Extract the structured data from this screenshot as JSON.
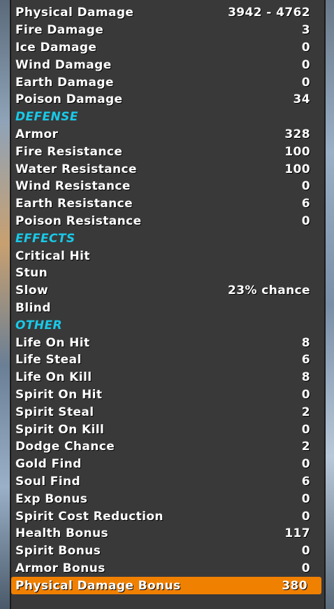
{
  "colors": {
    "section_header": "#19c9e8",
    "highlight": "#f08000",
    "panel": "#393939"
  },
  "rows": [
    {
      "label": "Physical Damage",
      "value": "3942 - 4762"
    },
    {
      "label": "Fire Damage",
      "value": "3"
    },
    {
      "label": "Ice Damage",
      "value": "0"
    },
    {
      "label": "Wind Damage",
      "value": "0"
    },
    {
      "label": "Earth Damage",
      "value": "0"
    },
    {
      "label": "Poison Damage",
      "value": "34"
    },
    {
      "label": "DEFENSE",
      "header": true
    },
    {
      "label": "Armor",
      "value": "328"
    },
    {
      "label": "Fire Resistance",
      "value": "100"
    },
    {
      "label": "Water Resistance",
      "value": "100"
    },
    {
      "label": "Wind Resistance",
      "value": "0"
    },
    {
      "label": "Earth Resistance",
      "value": "6"
    },
    {
      "label": "Poison Resistance",
      "value": "0"
    },
    {
      "label": "EFFECTS",
      "header": true
    },
    {
      "label": "Critical Hit",
      "value": ""
    },
    {
      "label": "Stun",
      "value": ""
    },
    {
      "label": "Slow",
      "value": "23% chance"
    },
    {
      "label": "Blind",
      "value": ""
    },
    {
      "label": "OTHER",
      "header": true
    },
    {
      "label": "Life On Hit",
      "value": "8"
    },
    {
      "label": "Life Steal",
      "value": "6"
    },
    {
      "label": "Life On Kill",
      "value": "8"
    },
    {
      "label": "Spirit On Hit",
      "value": "0"
    },
    {
      "label": "Spirit Steal",
      "value": "2"
    },
    {
      "label": "Spirit On Kill",
      "value": "0"
    },
    {
      "label": "Dodge Chance",
      "value": "2"
    },
    {
      "label": "Gold Find",
      "value": "0"
    },
    {
      "label": "Soul Find",
      "value": "6"
    },
    {
      "label": "Exp Bonus",
      "value": "0"
    },
    {
      "label": "Spirit Cost Reduction",
      "value": "0"
    },
    {
      "label": "Health Bonus",
      "value": "117"
    },
    {
      "label": "Spirit Bonus",
      "value": "0"
    },
    {
      "label": "Armor Bonus",
      "value": "0"
    },
    {
      "label": "Physical Damage Bonus",
      "value": "380",
      "highlight": true
    }
  ]
}
